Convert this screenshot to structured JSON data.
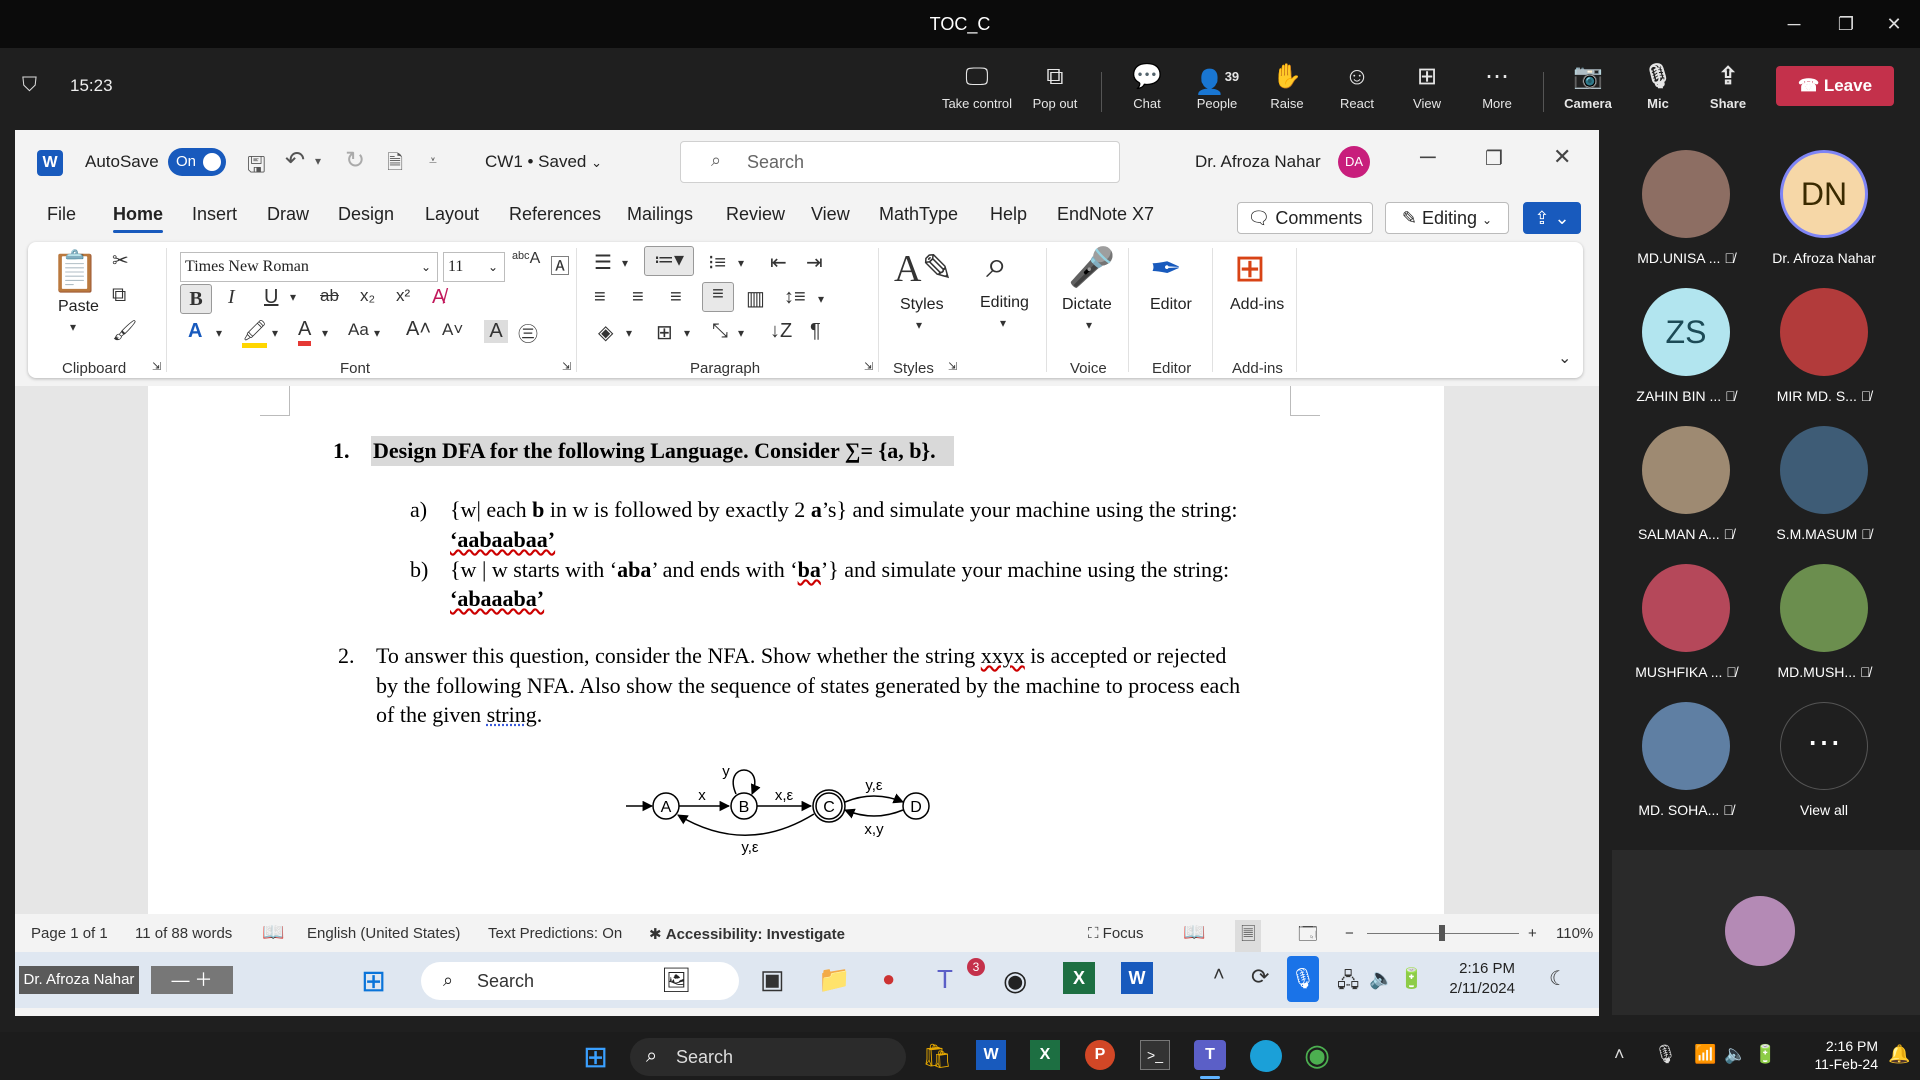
{
  "teams": {
    "window_title": "TOC_C",
    "timer": "15:23",
    "buttons": {
      "take_control": "Take control",
      "pop_out": "Pop out",
      "chat": "Chat",
      "people": "People",
      "people_count": "39",
      "raise": "Raise",
      "react": "React",
      "view": "View",
      "more": "More",
      "camera": "Camera",
      "mic": "Mic",
      "share": "Share",
      "leave": "Leave"
    }
  },
  "word": {
    "autosave_label": "AutoSave",
    "autosave_state": "On",
    "doc_name": "CW1 • Saved",
    "search_placeholder": "Search",
    "user_name": "Dr. Afroza Nahar",
    "user_initials": "DA",
    "tabs": [
      "File",
      "Home",
      "Insert",
      "Draw",
      "Design",
      "Layout",
      "References",
      "Mailings",
      "Review",
      "View",
      "MathType",
      "Help",
      "EndNote X7"
    ],
    "comments_label": "Comments",
    "editing_label": "Editing",
    "ribbon": {
      "font_name": "Times New Roman",
      "font_size": "11",
      "paste_label": "Paste",
      "styles_label": "Styles",
      "editing_label": "Editing",
      "dictate_label": "Dictate",
      "editor_label": "Editor",
      "addins_label": "Add-ins",
      "groups": {
        "clipboard": "Clipboard",
        "font": "Font",
        "paragraph": "Paragraph",
        "styles": "Styles",
        "voice": "Voice",
        "editor": "Editor",
        "addins": "Add-ins"
      }
    },
    "document": {
      "q1_num": "1.",
      "q1_text": "Design DFA for the following Language. Consider ∑= {a, b}.",
      "q1a_label": "a)",
      "q1a_pre": "{w| each ",
      "q1a_b": "b",
      "q1a_mid": " in w is followed by exactly 2 ",
      "q1a_a": "a",
      "q1a_post": "’s} and simulate your machine using the string:",
      "q1a_string": "‘aabaabaa’",
      "q1b_label": "b)",
      "q1b_pre": "{w | w starts with ‘",
      "q1b_aba": "aba",
      "q1b_mid": "’ and ends with ‘",
      "q1b_ba": "ba",
      "q1b_post": "’} and simulate your machine using the string:",
      "q1b_string": "‘abaaaba’",
      "q2_num": "2.",
      "q2_line1_pre": "To answer this question, consider the NFA. Show whether the string ",
      "q2_line1_word": "xxyx",
      "q2_line1_post": " is accepted or rejected",
      "q2_line2": "by the following NFA. Also show the sequence of states generated by the machine to process each",
      "q2_line3_pre": "of the given ",
      "q2_line3_word": "string",
      "q2_line3_post": ".",
      "nfa": {
        "states": [
          "A",
          "B",
          "C",
          "D"
        ],
        "labels": {
          "a_b": "x",
          "b_loop": "y",
          "b_c": "x,ε",
          "c_d": "y,ε",
          "d_c": "x,y",
          "c_a": "y,ε"
        }
      }
    },
    "status": {
      "page": "Page 1 of 1",
      "words": "11 of 88 words",
      "language": "English (United States)",
      "text_predictions": "Text Predictions: On",
      "accessibility": "Accessibility: Investigate",
      "focus": "Focus",
      "zoom": "110%"
    },
    "inner_taskbar": {
      "presenter": "Dr. Afroza Nahar",
      "search": "Search",
      "teams_badge": "3",
      "time": "2:16 PM",
      "date": "2/11/2024"
    }
  },
  "participants": [
    {
      "name": "MD.UNISA ...",
      "muted": true
    },
    {
      "name": "Dr. Afroza Nahar",
      "initials": "DN",
      "muted": false
    },
    {
      "name": "ZAHIN BIN ...",
      "initials": "ZS",
      "muted": true
    },
    {
      "name": "MIR MD. S...",
      "muted": true
    },
    {
      "name": "SALMAN A...",
      "muted": true
    },
    {
      "name": "S.M.MASUM",
      "muted": true
    },
    {
      "name": "MUSHFIKA ...",
      "muted": true
    },
    {
      "name": "MD.MUSH...",
      "muted": true
    },
    {
      "name": "MD. SOHA...",
      "muted": true
    },
    {
      "name": "View all",
      "muted": false
    }
  ],
  "taskbar": {
    "search": "Search",
    "time": "2:16 PM",
    "date": "11-Feb-24"
  },
  "colors": {
    "leave": "#c4314b",
    "word_blue": "#185abd",
    "mic_active": "#1a73e8"
  }
}
